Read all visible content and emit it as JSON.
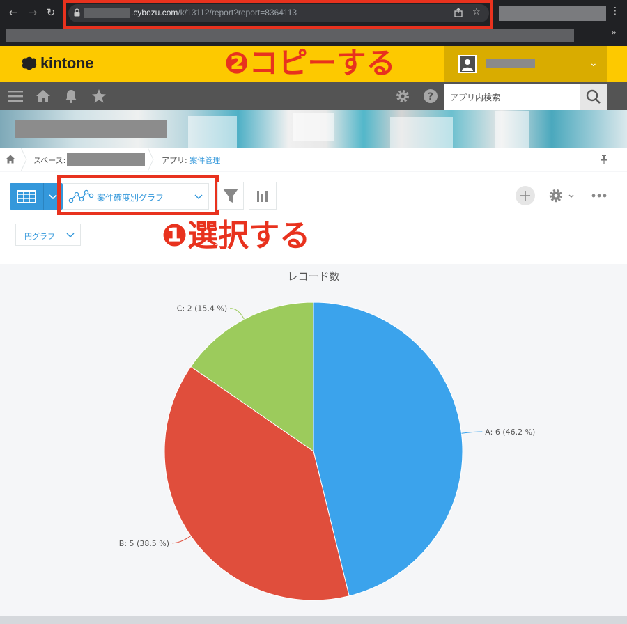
{
  "browser": {
    "url_domain": ".cybozu.com",
    "url_path": "/k/13112/report?report=8364113"
  },
  "header": {
    "logo_text": "kintone",
    "copy_annotation": "❷コピーする"
  },
  "toolbar": {
    "search_placeholder": "アプリ内検索"
  },
  "breadcrumb": {
    "space_label": "スペース:",
    "app_label": "アプリ:",
    "app_name": "案件管理"
  },
  "view": {
    "graph_name": "案件確度別グラフ",
    "chart_type": "円グラフ",
    "select_annotation": "❶選択する"
  },
  "colors": {
    "brand_yellow": "#fdc900",
    "annotation_red": "#e8321e",
    "link_blue": "#3498db"
  },
  "chart_data": {
    "type": "pie",
    "title": "レコード数",
    "categories": [
      "A",
      "B",
      "C"
    ],
    "values": [
      6,
      5,
      2
    ],
    "percents": [
      46.2,
      38.5,
      15.4
    ],
    "labels": [
      "A: 6 (46.2 %)",
      "B: 5 (38.5 %)",
      "C: 2 (15.4 %)"
    ],
    "colors": [
      "#3ba3ec",
      "#e04e3c",
      "#9ccb5c"
    ]
  }
}
